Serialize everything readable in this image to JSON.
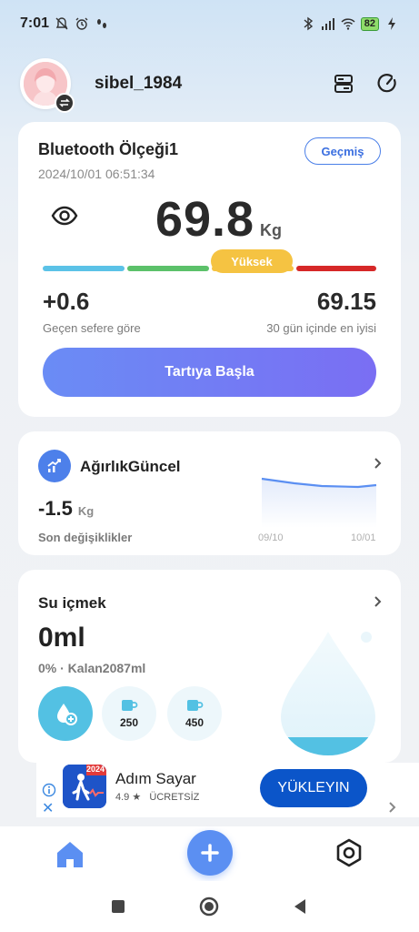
{
  "status_bar": {
    "time": "7:01",
    "battery": "82"
  },
  "header": {
    "username": "sibel_1984"
  },
  "scale_card": {
    "device_name": "Bluetooth Ölçeği1",
    "timestamp": "2024/10/01 06:51:34",
    "history_label": "Geçmiş",
    "weight": "69.8",
    "unit": "Kg",
    "status_label": "Yüksek",
    "change_value": "+0.6",
    "change_label": "Geçen sefere göre",
    "best_value": "69.15",
    "best_label": "30 gün içinde en iyisi",
    "start_button": "Tartıya Başla",
    "bar_colors": [
      "#5bc2e7",
      "#5cc16a",
      "#f5c342",
      "#d62828"
    ]
  },
  "weight_card": {
    "title": "AğırlıkGüncel",
    "value": "-1.5",
    "unit": "Kg",
    "subtitle": "Son değişiklikler",
    "date_start": "09/10",
    "date_end": "10/01"
  },
  "water_card": {
    "title": "Su içmek",
    "value": "0ml",
    "subtitle": "0% · Kalan2087ml",
    "cup_small": "250",
    "cup_large": "450",
    "fill_fraction": 0.0
  },
  "ad": {
    "title": "Adım Sayar",
    "rating": "4.9 ★",
    "price": "ÜCRETSİZ",
    "cta": "YÜKLEYIN",
    "badge_year": "2024"
  },
  "colors": {
    "accent": "#5b8ff2",
    "water": "#53c1e3",
    "ad_button": "#0b55c9"
  }
}
